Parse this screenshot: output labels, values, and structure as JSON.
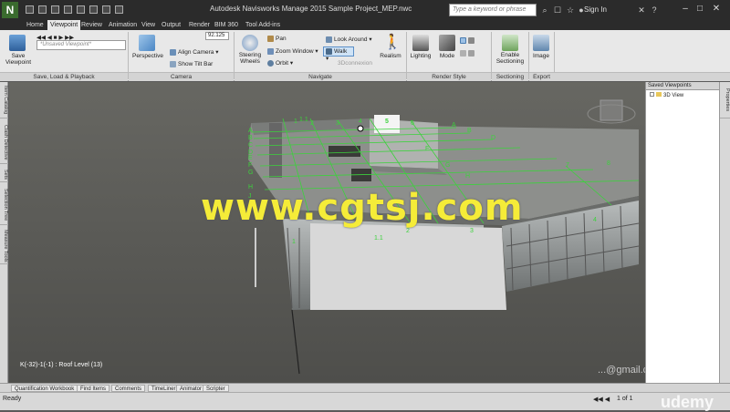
{
  "window": {
    "title": "Autodesk Navisworks Manage 2015    Sample Project_MEP.nwc",
    "app_logo": "N",
    "search_placeholder": "Type a keyword or phrase",
    "sign_in": "Sign In"
  },
  "tabs": [
    "Home",
    "Viewpoint",
    "Review",
    "Animation",
    "View",
    "Output",
    "Render",
    "BIM 360",
    "Tool Add-ins"
  ],
  "active_tab": "Viewpoint",
  "ribbon": {
    "save_viewpoint": "Save\nViewpoint",
    "viewpoint_dropdown": "*Unsaved Viewpoint*",
    "perspective": "Perspective",
    "value_box": "92.125",
    "align_camera": "Align Camera",
    "show_tilt_bar": "Show Tilt Bar",
    "steering_wheels": "Steering\nWheels",
    "pan": "Pan",
    "zoom_window": "Zoom Window",
    "orbit": "Orbit",
    "look_around": "Look Around",
    "walk": "Walk",
    "connexion": "3Dconnexion",
    "realism": "Realism",
    "lighting": "Lighting",
    "mode": "Mode",
    "enable_sectioning": "Enable\nSectioning",
    "image": "Image",
    "groups": {
      "save_load": "Save, Load & Playback",
      "camera": "Camera",
      "navigate": "Navigate",
      "render_style": "Render Style",
      "sectioning": "Sectioning",
      "export": "Export"
    }
  },
  "left_tabs": [
    "Item Catalog",
    "Clash Detective",
    "Sets",
    "Selection Tree",
    "Measure Tools"
  ],
  "right_tabs": [
    "Properties"
  ],
  "saved_viewpoints": {
    "title": "Saved Viewpoints",
    "item": "3D View"
  },
  "viewport": {
    "level_status": "K(-32)-1(-1) : Roof Level (13)",
    "watermark": "www.cgtsj.com",
    "email_watermark": "...@gmail.com",
    "grid_labels_top": [
      "1",
      "1.1",
      "2",
      "3",
      "4",
      "5",
      "6",
      "A",
      "B",
      "D",
      "E",
      "G",
      "H",
      "7",
      "8"
    ],
    "grid_labels_left": [
      "A",
      "B",
      "C",
      "D",
      "E",
      "F",
      "G",
      "H",
      "J"
    ],
    "grid_labels_front": [
      "1",
      "1.1",
      "2",
      "3",
      "4"
    ]
  },
  "bottom_tabs": [
    "Quantification Workbook",
    "Find Items",
    "Comments",
    "TimeLiner",
    "Animator",
    "Scripter"
  ],
  "status": {
    "ready": "Ready",
    "page": "1 of 1",
    "brand": "udemy"
  },
  "colors": {
    "grid_green": "#3cd23c",
    "watermark_yellow": "#f5ec38",
    "titlebar": "#2b2b2b",
    "ribbon": "#e8e8e8"
  }
}
